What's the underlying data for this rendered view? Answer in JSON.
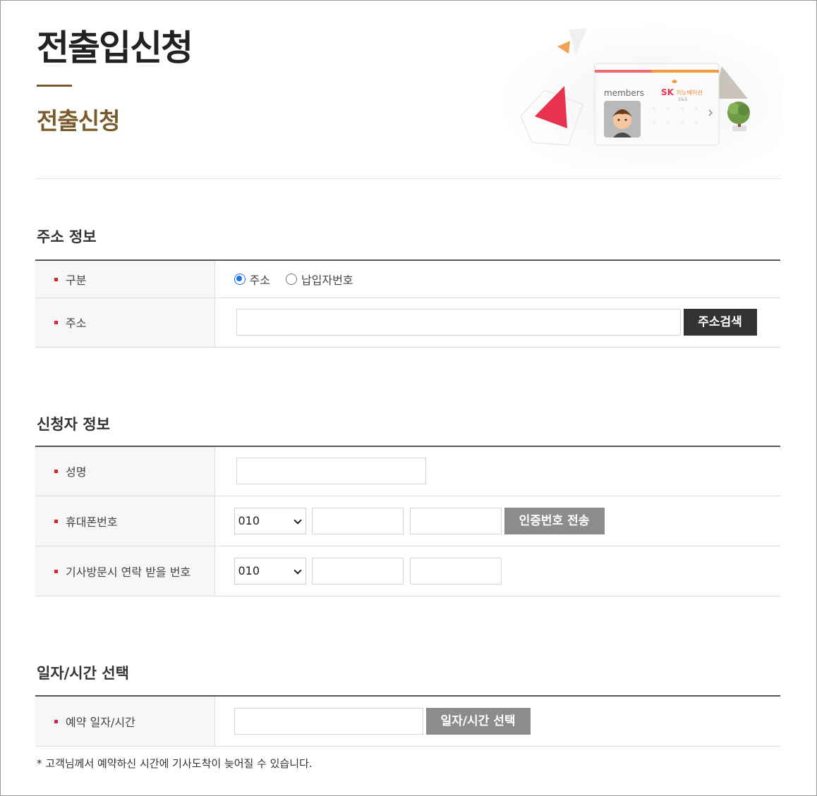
{
  "header": {
    "title": "전출입신청",
    "subtitle": "전출신청"
  },
  "hero": {
    "card_label": "members",
    "brand_sk": "SK",
    "brand_name": "이노베이션",
    "brand_sub": "E&S"
  },
  "address_section": {
    "title": "주소 정보",
    "type_label": "구분",
    "type_options": [
      {
        "label": "주소",
        "checked": true
      },
      {
        "label": "납입자번호",
        "checked": false
      }
    ],
    "address_label": "주소",
    "address_value": "",
    "search_button": "주소검색"
  },
  "applicant_section": {
    "title": "신청자 정보",
    "name_label": "성명",
    "name_value": "",
    "phone_label": "휴대폰번호",
    "phone_prefix": "010",
    "phone_mid": "",
    "phone_last": "",
    "send_code_button": "인증번호 전송",
    "visit_label": "기사방문시 연락 받을 번호",
    "visit_prefix": "010",
    "visit_mid": "",
    "visit_last": ""
  },
  "schedule_section": {
    "title": "일자/시간 선택",
    "reserve_label": "예약 일자/시간",
    "reserve_value": "",
    "select_button": "일자/시간 선택"
  },
  "footer_note": "* 고객님께서 예약하신 시간에 기사도착이 늦어질 수 있습니다.",
  "colors": {
    "accent_brown": "#7a5a2a",
    "required_mark": "#d9263b",
    "dark_button": "#333333",
    "gray_button": "#8c8c8c",
    "radio_blue": "#1a73e8"
  }
}
